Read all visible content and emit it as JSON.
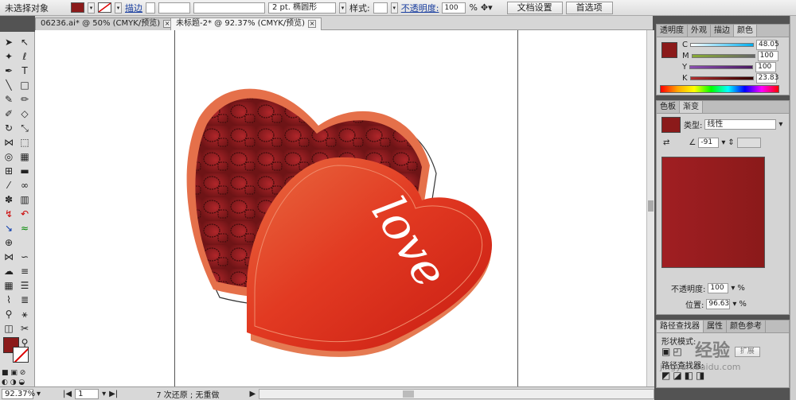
{
  "control_bar": {
    "selection": "未选择对象",
    "stroke_link": "描边",
    "stroke_weight": "2 pt. 椭圆形",
    "style_label": "样式:",
    "opacity_label": "不透明度:",
    "opacity_value": "100",
    "opacity_unit": "%",
    "doc_setup": "文档设置",
    "preferences": "首选项",
    "fill_color": "#8b1a1a"
  },
  "tabs": [
    {
      "label": "06236.ai* @ 50% (CMYK/预览)"
    },
    {
      "label": "未标题-2* @ 92.37% (CMYK/预览)"
    }
  ],
  "artwork": {
    "text": "love",
    "box_color": "#8b1a1a",
    "lid_color": "#e03020"
  },
  "status": {
    "zoom": "92.37%",
    "page": "1",
    "history": "7 次还原 ; 无重做"
  },
  "color_panel": {
    "tabs": [
      "透明度",
      "外观",
      "描边",
      "颜色"
    ],
    "c_label": "C",
    "c_value": "48.05",
    "m_label": "M",
    "m_value": "100",
    "y_label": "Y",
    "y_value": "100",
    "k_label": "K",
    "k_value": "23.83",
    "color": "#8b1a1a"
  },
  "gradient_panel": {
    "tabs": [
      "色板",
      "渐变"
    ],
    "type_label": "类型:",
    "type_value": "线性",
    "angle_value": "-91",
    "opacity_label": "不透明度:",
    "opacity_value": "100",
    "location_label": "位置:",
    "location_value": "96.63",
    "percent": "%"
  },
  "bottom_panel": {
    "tabs": [
      "路径查找器",
      "属性",
      "颜色参考"
    ],
    "shape_modes": "形状模式:",
    "pathfinder": "路径查找器:",
    "expand": "扩展"
  },
  "watermark": {
    "brand": "经验",
    "site": "jingyan.baidu.com"
  }
}
